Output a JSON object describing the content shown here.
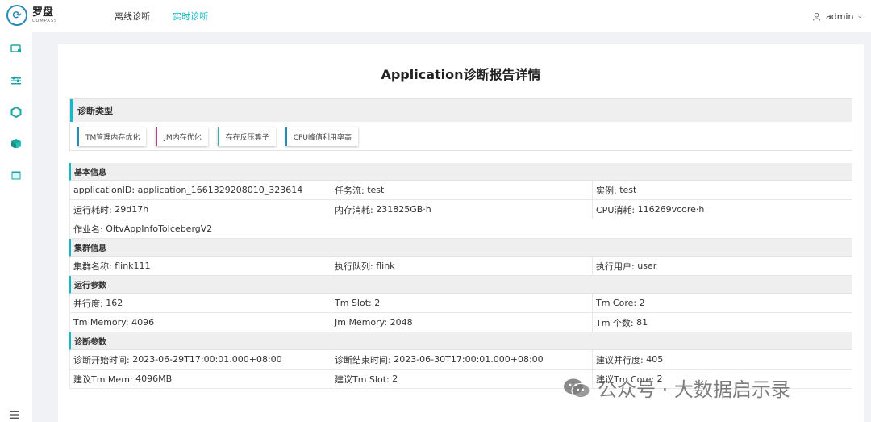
{
  "app": {
    "logo_mark": "⟳",
    "logo_title": "罗盘",
    "logo_sub": "COMPASS"
  },
  "nav": {
    "offline": "离线诊断",
    "realtime": "实时诊断"
  },
  "user": {
    "name": "admin"
  },
  "page": {
    "title": "Application诊断报告详情"
  },
  "diag_type": {
    "header": "诊断类型",
    "tags": [
      "TM管理内存优化",
      "JM内存优化",
      "存在反压算子",
      "CPU峰值利用率高"
    ],
    "tag_colors": [
      "#2a8ab8",
      "#c23a8b",
      "#2fb8a8",
      "#2a8ab8"
    ]
  },
  "basic": {
    "header": "基本信息",
    "appid_label": "applicationID:",
    "appid": "application_1661329208010_323614",
    "flow_label": "任务流:",
    "flow": "test",
    "instance_label": "实例:",
    "instance": "test",
    "runtime_label": "运行耗时:",
    "runtime": "29d17h",
    "mem_label": "内存消耗:",
    "mem": "231825GB·h",
    "cpu_label": "CPU消耗:",
    "cpu": "116269vcore·h",
    "job_label": "作业名:",
    "job": "OltvAppInfoToIcebergV2"
  },
  "cluster": {
    "header": "集群信息",
    "cluster_label": "集群名称:",
    "cluster": "flink111",
    "queue_label": "执行队列:",
    "queue": "flink",
    "user_label": "执行用户:",
    "user": "user"
  },
  "params": {
    "header": "运行参数",
    "parallel_label": "并行度:",
    "parallel": "162",
    "tmslot_label": "Tm Slot:",
    "tmslot": "2",
    "tmcore_label": "Tm Core:",
    "tmcore": "2",
    "tmmem_label": "Tm Memory:",
    "tmmem": "4096",
    "jmmem_label": "Jm Memory:",
    "jmmem": "2048",
    "tmcount_label": "Tm 个数:",
    "tmcount": "81"
  },
  "diag_params": {
    "header": "诊断参数",
    "start_label": "诊断开始时间:",
    "start": "2023-06-29T17:00:01.000+08:00",
    "end_label": "诊断结束时间:",
    "end": "2023-06-30T17:00:01.000+08:00",
    "sugg_par_label": "建议并行度:",
    "sugg_par": "405",
    "sugg_mem_label": "建议Tm Mem:",
    "sugg_mem": "4096MB",
    "sugg_slot_label": "建议Tm Slot:",
    "sugg_slot": "2",
    "sugg_core_label": "建议Tm Core:",
    "sugg_core": "2"
  },
  "watermark": {
    "text": "公众号 · 大数据启示录"
  }
}
